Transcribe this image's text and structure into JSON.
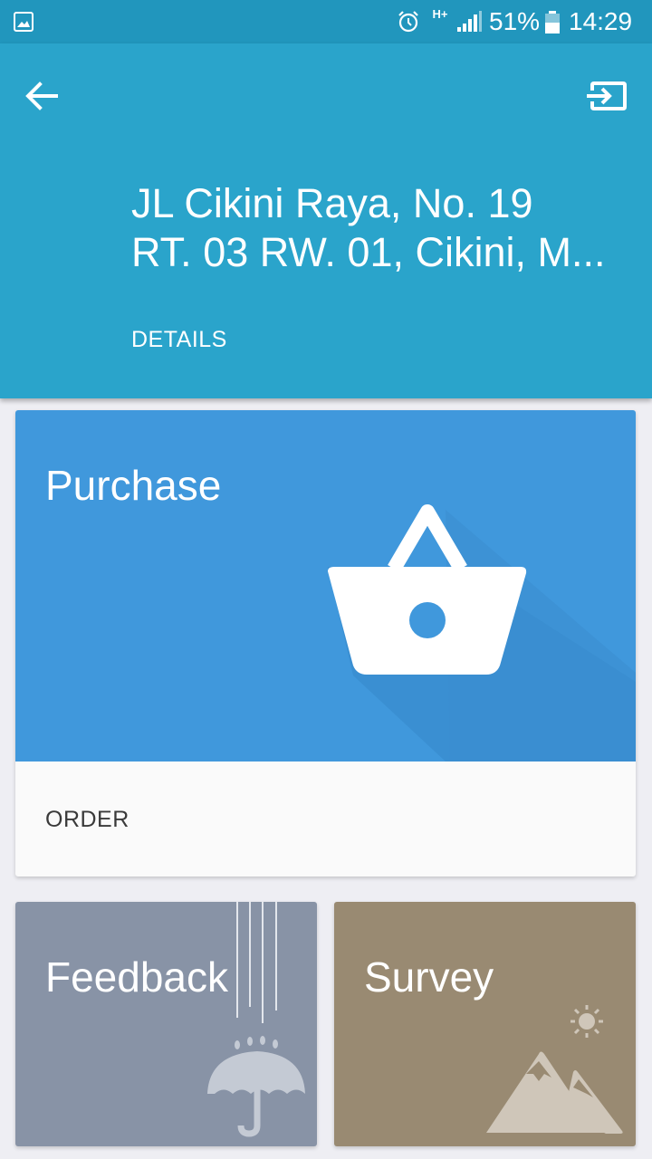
{
  "status_bar": {
    "network_type": "H+",
    "battery": "51%",
    "time": "14:29",
    "icons": [
      "gallery-icon",
      "alarm-icon",
      "signal-icon",
      "battery-icon"
    ]
  },
  "header": {
    "address_line1": "JL Cikini Raya, No. 19",
    "address_line2": "RT. 03 RW. 01, Cikini, M...",
    "details_label": "DETAILS",
    "icons": [
      "back-arrow-icon",
      "logout-icon"
    ]
  },
  "purchase_card": {
    "title": "Purchase",
    "action_label": "ORDER",
    "icon": "basket-icon",
    "color": "#4098dc"
  },
  "feedback_card": {
    "title": "Feedback",
    "icon": "umbrella-rain-icon",
    "color": "#8893a6"
  },
  "survey_card": {
    "title": "Survey",
    "icon": "mountain-sun-icon",
    "color": "#998a72"
  },
  "colors": {
    "status_bar": "#2196bd",
    "app_bar": "#2aa4cb",
    "background": "#eeeef3"
  }
}
